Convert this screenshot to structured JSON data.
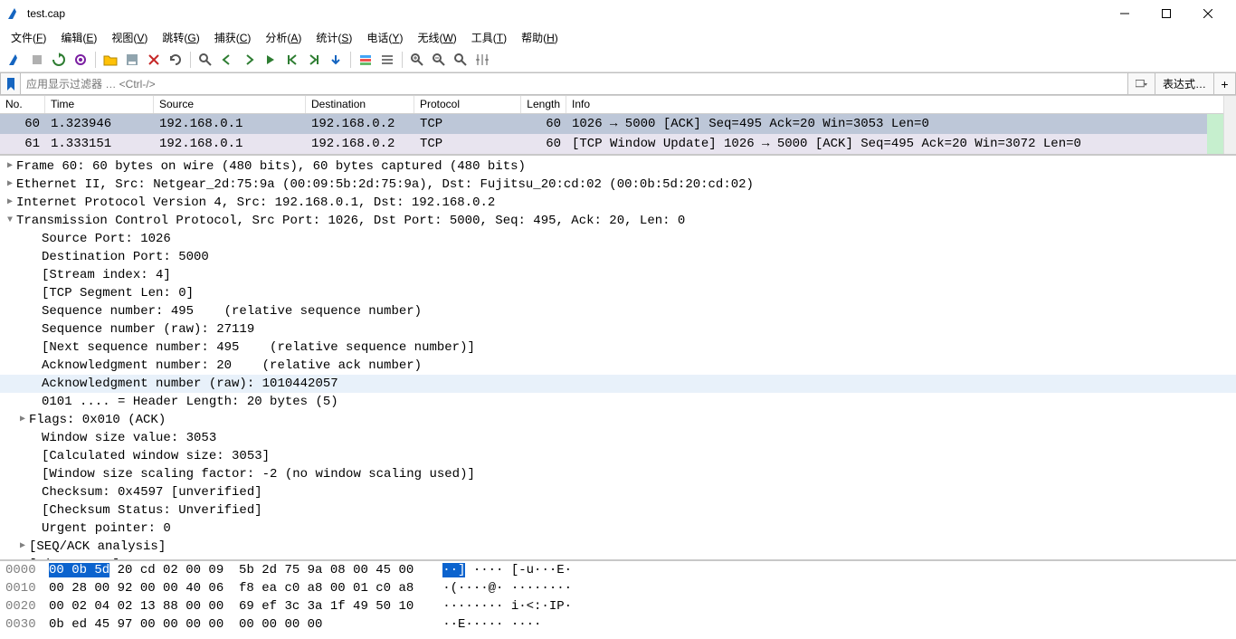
{
  "title": "test.cap",
  "menus": [
    "文件(F)",
    "编辑(E)",
    "视图(V)",
    "跳转(G)",
    "捕获(C)",
    "分析(A)",
    "统计(S)",
    "电话(Y)",
    "无线(W)",
    "工具(T)",
    "帮助(H)"
  ],
  "filter": {
    "placeholder": "应用显示过滤器 … <Ctrl-/>",
    "expression_label": "表达式…"
  },
  "packet_headers": {
    "no": "No.",
    "time": "Time",
    "source": "Source",
    "destination": "Destination",
    "protocol": "Protocol",
    "length": "Length",
    "info": "Info"
  },
  "packets": [
    {
      "no": "60",
      "time": "1.323946",
      "src": "192.168.0.1",
      "dst": "192.168.0.2",
      "proto": "TCP",
      "len": "60",
      "info": "1026 → 5000 [ACK] Seq=495 Ack=20 Win=3053 Len=0",
      "cls": "selected"
    },
    {
      "no": "61",
      "time": "1.333151",
      "src": "192.168.0.1",
      "dst": "192.168.0.2",
      "proto": "TCP",
      "len": "60",
      "info": "[TCP Window Update] 1026 → 5000 [ACK] Seq=495 Ack=20 Win=3072 Len=0",
      "cls": "window-update"
    }
  ],
  "details": [
    {
      "exp": ">",
      "ind": 0,
      "text": "Frame 60: 60 bytes on wire (480 bits), 60 bytes captured (480 bits)"
    },
    {
      "exp": ">",
      "ind": 0,
      "text": "Ethernet II, Src: Netgear_2d:75:9a (00:09:5b:2d:75:9a), Dst: Fujitsu_20:cd:02 (00:0b:5d:20:cd:02)"
    },
    {
      "exp": ">",
      "ind": 0,
      "text": "Internet Protocol Version 4, Src: 192.168.0.1, Dst: 192.168.0.2"
    },
    {
      "exp": "v",
      "ind": 0,
      "text": "Transmission Control Protocol, Src Port: 1026, Dst Port: 5000, Seq: 495, Ack: 20, Len: 0"
    },
    {
      "exp": "",
      "ind": 2,
      "text": "Source Port: 1026"
    },
    {
      "exp": "",
      "ind": 2,
      "text": "Destination Port: 5000"
    },
    {
      "exp": "",
      "ind": 2,
      "text": "[Stream index: 4]"
    },
    {
      "exp": "",
      "ind": 2,
      "text": "[TCP Segment Len: 0]"
    },
    {
      "exp": "",
      "ind": 2,
      "text": "Sequence number: 495    (relative sequence number)"
    },
    {
      "exp": "",
      "ind": 2,
      "text": "Sequence number (raw): 27119"
    },
    {
      "exp": "",
      "ind": 2,
      "text": "[Next sequence number: 495    (relative sequence number)]"
    },
    {
      "exp": "",
      "ind": 2,
      "text": "Acknowledgment number: 20    (relative ack number)"
    },
    {
      "exp": "",
      "ind": 2,
      "text": "Acknowledgment number (raw): 1010442057",
      "hl": true
    },
    {
      "exp": "",
      "ind": 2,
      "text": "0101 .... = Header Length: 20 bytes (5)"
    },
    {
      "exp": ">",
      "ind": 1,
      "text": "Flags: 0x010 (ACK)"
    },
    {
      "exp": "",
      "ind": 2,
      "text": "Window size value: 3053"
    },
    {
      "exp": "",
      "ind": 2,
      "text": "[Calculated window size: 3053]"
    },
    {
      "exp": "",
      "ind": 2,
      "text": "[Window size scaling factor: -2 (no window scaling used)]"
    },
    {
      "exp": "",
      "ind": 2,
      "text": "Checksum: 0x4597 [unverified]"
    },
    {
      "exp": "",
      "ind": 2,
      "text": "[Checksum Status: Unverified]"
    },
    {
      "exp": "",
      "ind": 2,
      "text": "Urgent pointer: 0"
    },
    {
      "exp": ">",
      "ind": 1,
      "text": "[SEQ/ACK analysis]"
    },
    {
      "exp": ">",
      "ind": 1,
      "text": "[Timestamps]"
    }
  ],
  "bytes": [
    {
      "offset": "0000",
      "hex_sel": "00 0b 5d",
      "hex_rest": " 20 cd 02 00 09  5b 2d 75 9a 08 00 45 00",
      "ascii_pre": "   ",
      "ascii_sel": "··]",
      "ascii_post": " ···· [-u···E·"
    },
    {
      "offset": "0010",
      "hex_sel": "",
      "hex_rest": "00 28 00 92 00 00 40 06  f8 ea c0 a8 00 01 c0 a8",
      "ascii_pre": "   ",
      "ascii_sel": "",
      "ascii_post": "·(····@· ········"
    },
    {
      "offset": "0020",
      "hex_sel": "",
      "hex_rest": "00 02 04 02 13 88 00 00  69 ef 3c 3a 1f 49 50 10",
      "ascii_pre": "   ",
      "ascii_sel": "",
      "ascii_post": "········ i·<:·IP·"
    },
    {
      "offset": "0030",
      "hex_sel": "",
      "hex_rest": "0b ed 45 97 00 00 00 00  00 00 00 00",
      "ascii_pre": "   ",
      "ascii_sel": "",
      "ascii_post": "··E····· ····"
    }
  ]
}
